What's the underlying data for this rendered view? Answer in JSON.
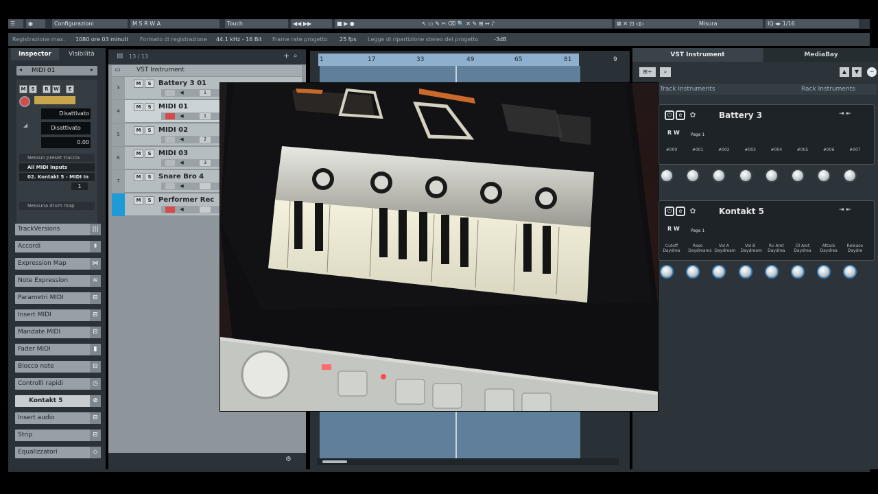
{
  "toolbar": {
    "items": [
      "Configurazioni",
      "Touch",
      "Misura",
      "1/16"
    ]
  },
  "status": {
    "rec_max_label": "Registrazione max.",
    "rec_max_value": "1080 ore 03 minuti",
    "format_label": "Formato di registrazione",
    "format_value": "44.1 kHz - 16 Bit",
    "framerate_label": "Frame rate progetto",
    "framerate_value": "25 fps",
    "panlaw_label": "Legge di ripartizione stereo del progetto",
    "panlaw_value": "-3dB"
  },
  "inspector": {
    "tab_inspector": "Inspector",
    "tab_visibility": "Visibilità",
    "track_name": "MIDI 01",
    "disattivato_1": "Disattivato",
    "disattivato_2": "Disattivato",
    "volume": "0.00",
    "preset": "Nessun preset traccia",
    "input": "All MIDI Inputs",
    "output": "02. Kontakt 5 - MIDI In",
    "channel": "1",
    "drum_map": "Nessuna drum map",
    "sections": [
      "TrackVersions",
      "Accordi",
      "Expression Map",
      "Note Expression",
      "Parametri MIDI",
      "Insert MIDI",
      "Mandate MIDI",
      "Fader MIDI",
      "Blocco note",
      "Controlli rapidi",
      "Kontakt 5",
      "Insert audio",
      "Strip",
      "Equalizzatori"
    ]
  },
  "tracklist": {
    "count": "13 / 13",
    "folder": "VST Instrument",
    "tracks": [
      {
        "num": "3",
        "name": "Battery 3 01",
        "ch": "1",
        "rec": false
      },
      {
        "num": "4",
        "name": "MIDI 01",
        "ch": "1",
        "rec": true
      },
      {
        "num": "5",
        "name": "MIDI 02",
        "ch": "2",
        "rec": false
      },
      {
        "num": "6",
        "name": "MIDI 03",
        "ch": "3",
        "rec": false
      },
      {
        "num": "7",
        "name": "Snare Bro 4",
        "ch": "",
        "rec": false
      },
      {
        "num": "",
        "name": "Performer Rec",
        "ch": "",
        "rec": true
      }
    ]
  },
  "ruler": {
    "marks": [
      "1",
      "17",
      "33",
      "49",
      "65",
      "81",
      "9"
    ]
  },
  "rightzone": {
    "tab_vst": "VST Instrument",
    "tab_mediabay": "MediaBay",
    "track_instruments": "Track Instruments",
    "rack_instruments": "Rack Instruments",
    "racks": [
      {
        "name": "Battery 3",
        "page": "Page 1",
        "slots": [
          "#000",
          "#001",
          "#002",
          "#003",
          "#004",
          "#005",
          "#006",
          "#007"
        ]
      },
      {
        "name": "Kontakt 5",
        "page": "Page 1",
        "slots": [
          "Cutoff\nDaydrea",
          "Raso\nDaydreams",
          "Vol A\nDaydream",
          "Vol B\nDaydream",
          "Rv Amt\nDaydrea",
          "Dl Amt\nDaydrea",
          "Attack\nDaydrea",
          "Release\nDaydre"
        ]
      }
    ]
  },
  "colors": {
    "accent_blue": "#1e9bd7",
    "record_red": "#d64a4a",
    "lane_blue": "#5f7f9a"
  }
}
